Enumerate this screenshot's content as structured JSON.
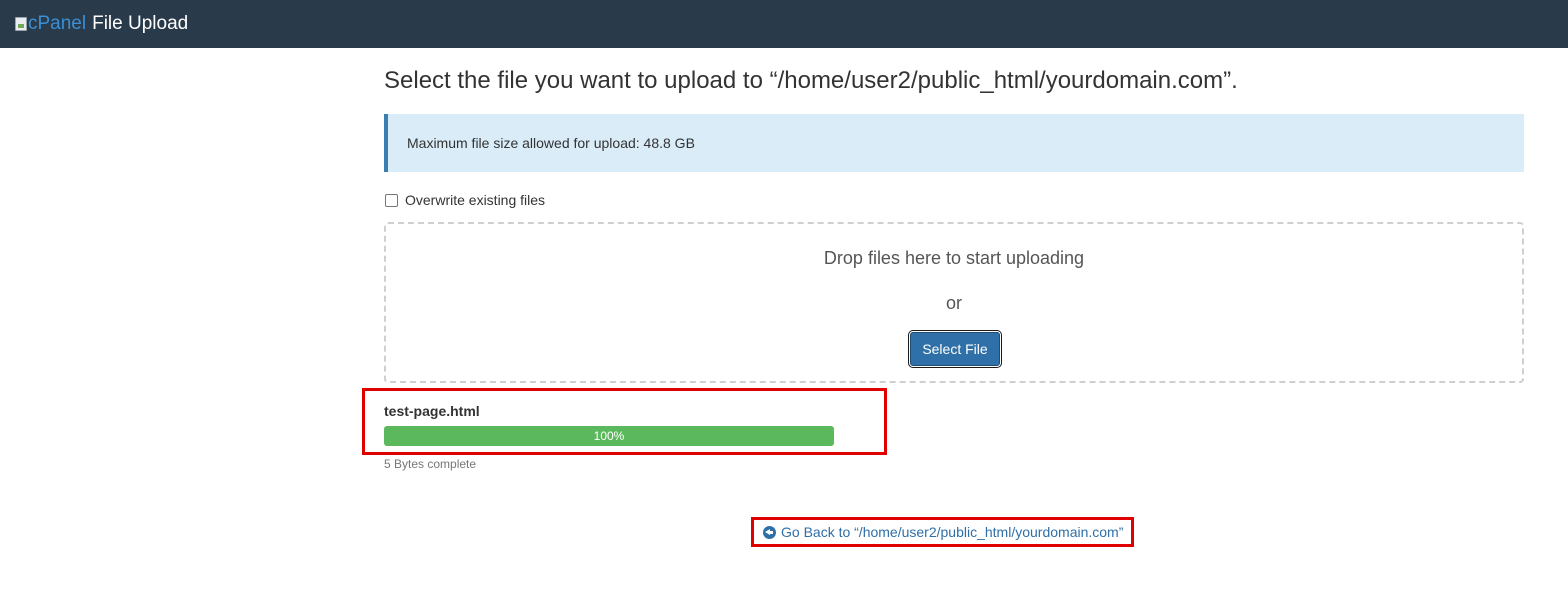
{
  "header": {
    "logo_alt": "cPanel",
    "title": "File Upload"
  },
  "main": {
    "title": "Select the file you want to upload to “/home/user2/public_html/yourdomain.com”.",
    "info": "Maximum file size allowed for upload: 48.8 GB",
    "overwrite_label": "Overwrite existing files",
    "overwrite_checked": false,
    "dropzone": {
      "drop_text": "Drop files here to start uploading",
      "or_text": "or",
      "select_button": "Select File"
    },
    "upload": {
      "file_name": "test-page.html",
      "progress_percent": 100,
      "progress_label": "100%",
      "status": "5 Bytes complete"
    },
    "go_back": "Go Back to “/home/user2/public_html/yourdomain.com”"
  },
  "colors": {
    "header_bg": "#293a4a",
    "info_bg": "#d9ecf8",
    "progress": "#5cb85c",
    "primary": "#2f70a8",
    "link": "#2f6fa7",
    "highlight": "#e00000"
  },
  "icons": {
    "broken_image": "broken-image-icon",
    "go_back": "circle-arrow-left-icon"
  }
}
